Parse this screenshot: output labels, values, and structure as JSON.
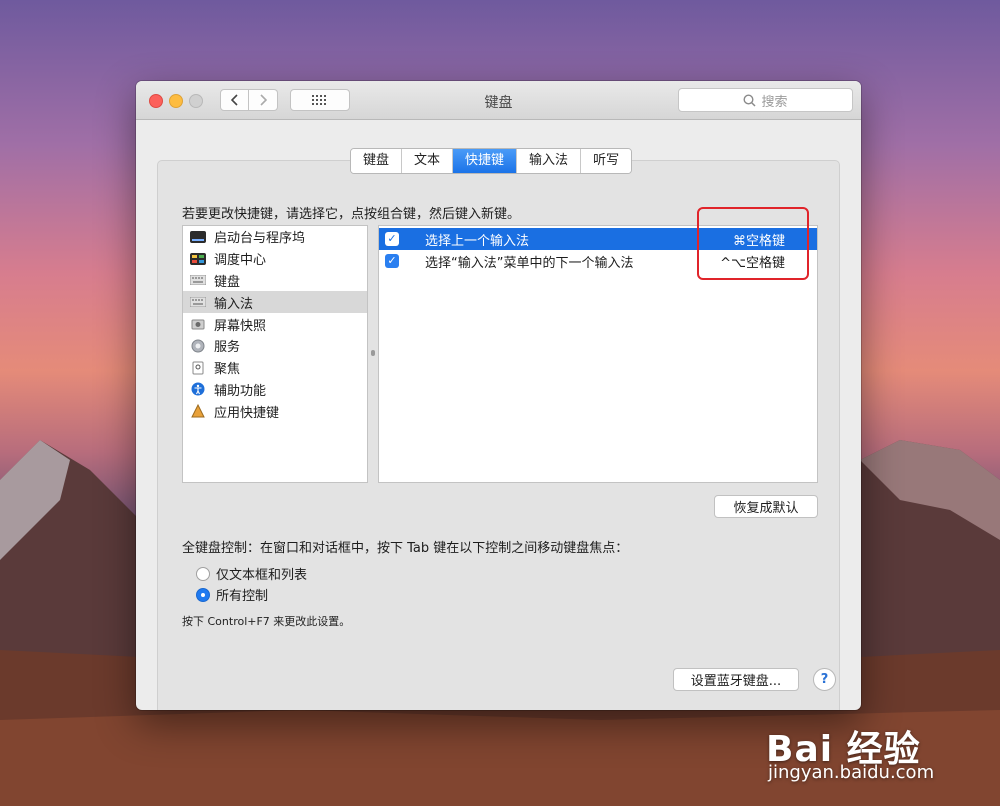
{
  "window": {
    "title": "键盘",
    "search_placeholder": "搜索"
  },
  "tabs": [
    {
      "label": "键盘"
    },
    {
      "label": "文本"
    },
    {
      "label": "快捷键",
      "active": true
    },
    {
      "label": "输入法"
    },
    {
      "label": "听写"
    }
  ],
  "instruction": "若要更改快捷键，请选择它，点按组合键，然后键入新键。",
  "categories": [
    {
      "label": "启动台与程序坞",
      "icon": "launchpad-icon"
    },
    {
      "label": "调度中心",
      "icon": "mission-control-icon"
    },
    {
      "label": "键盘",
      "icon": "keyboard-icon"
    },
    {
      "label": "输入法",
      "icon": "keyboard-icon",
      "selected": true
    },
    {
      "label": "屏幕快照",
      "icon": "screenshot-icon"
    },
    {
      "label": "服务",
      "icon": "gear-icon"
    },
    {
      "label": "聚焦",
      "icon": "spotlight-icon"
    },
    {
      "label": "辅助功能",
      "icon": "accessibility-icon"
    },
    {
      "label": "应用快捷键",
      "icon": "app-shortcuts-icon"
    }
  ],
  "shortcuts": [
    {
      "label": "选择上一个输入法",
      "key": "⌘空格键",
      "checked": true,
      "selected": true
    },
    {
      "label": "选择“输入法”菜单中的下一个输入法",
      "key": "^⌥空格键",
      "checked": true,
      "selected": false
    }
  ],
  "restore_defaults_label": "恢复成默认",
  "keyboard_control": {
    "label": "全键盘控制：在窗口和对话框中，按下 Tab 键在以下控制之间移动键盘焦点：",
    "options": [
      {
        "label": "仅文本框和列表",
        "selected": false
      },
      {
        "label": "所有控制",
        "selected": true
      }
    ],
    "hint": "按下 Control+F7 来更改此设置。"
  },
  "bluetooth_button_label": "设置蓝牙键盘...",
  "help_label": "?",
  "watermark": {
    "logo": "Bai 经验",
    "url": "jingyan.baidu.com"
  },
  "colors": {
    "accent": "#1a6fe2",
    "highlight_box": "#e0242a"
  }
}
